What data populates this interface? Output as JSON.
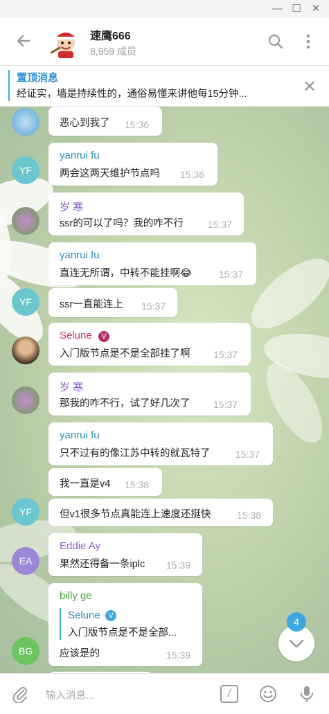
{
  "window": {
    "minimize": "—",
    "maximize": "☐",
    "close": "✕"
  },
  "header": {
    "title": "速鹰666",
    "subtitle": "8,959 成员",
    "back_icon": "arrow-left-icon",
    "search_icon": "search-icon",
    "menu_icon": "more-vert-icon"
  },
  "pinned": {
    "label": "置顶消息",
    "text": "经证实，墙是持续性的，通俗易懂来讲他每15分钟...",
    "close": "✕"
  },
  "messages": [
    {
      "text": "恶心到我了",
      "time": "15:36"
    },
    {
      "sender": "yanrui fu",
      "text": "两会这两天维护节点吗",
      "time": "15:36",
      "avatar": "YF"
    },
    {
      "sender": "岁 寒",
      "text": "ssr的可以了吗？我的咋不行",
      "time": "15:37"
    },
    {
      "sender": "yanrui fu",
      "text": "直连无所谓，中转不能挂啊😂",
      "time": "15:37"
    },
    {
      "text": "ssr一直能连上",
      "time": "15:37",
      "avatar": "YF"
    },
    {
      "sender": "Selune",
      "verified": "V",
      "text": "入门版节点是不是全部挂了啊",
      "time": "15:37"
    },
    {
      "sender": "岁 寒",
      "text": "那我的咋不行，试了好几次了",
      "time": "15:37"
    },
    {
      "sender": "yanrui fu",
      "text": "只不过有的像江苏中转的就瓦特了",
      "time": "15:37"
    },
    {
      "text": "我一直是v4",
      "time": "15:38"
    },
    {
      "text": "但v1很多节点真能连上速度还挺快",
      "time": "15:38",
      "avatar": "YF"
    },
    {
      "sender": "Eddie Ay",
      "text": "果然还得备一条iplc",
      "time": "15:39",
      "avatar": "EA"
    },
    {
      "sender": "billy ge",
      "reply_sender": "Selune",
      "reply_verified": "V",
      "reply_text": "入门版节点是不是全部...",
      "text": "应该是的",
      "time": "15:39",
      "avatar": "BG"
    }
  ],
  "scroll": {
    "unread": "4",
    "icon": "chevron-down-icon"
  },
  "composer": {
    "placeholder": "输入消息...",
    "attach_icon": "paperclip-icon",
    "command_icon": "slash-command-icon",
    "command_glyph": "/",
    "emoji_icon": "emoji-icon",
    "mic_icon": "microphone-icon"
  },
  "colors": {
    "accent": "#3ea7e0",
    "yanrui": "#2a8fb8",
    "suihan": "#8a5fc8",
    "selune": "#c9396a",
    "eddie": "#8a5fc8",
    "billy": "#4aa53a"
  }
}
